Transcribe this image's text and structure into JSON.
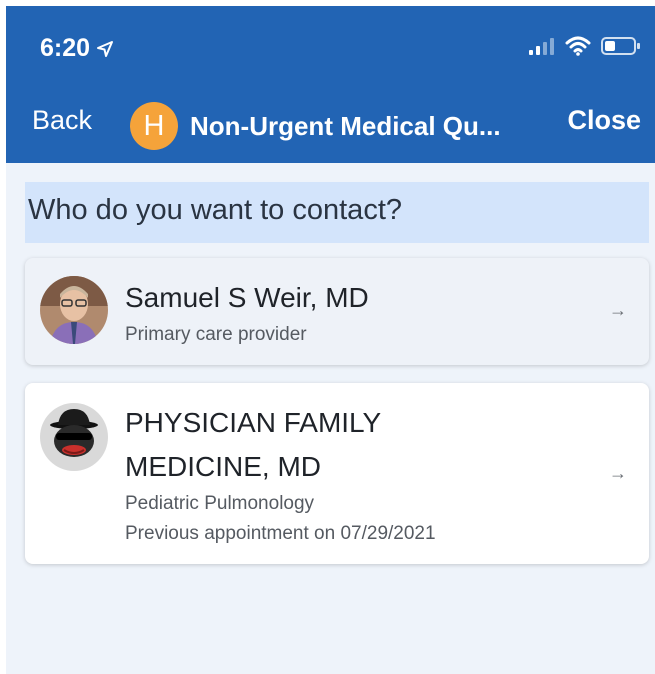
{
  "status_bar": {
    "time": "6:20"
  },
  "nav": {
    "back_label": "Back",
    "org_initial": "H",
    "title": "Non-Urgent Medical Qu...",
    "close_label": "Close"
  },
  "prompt": "Who do you want to contact?",
  "providers": [
    {
      "name": "Samuel S Weir, MD",
      "details": [
        "Primary care provider"
      ]
    },
    {
      "name_line1": "PHYSICIAN FAMILY",
      "name_line2": "MEDICINE, MD",
      "details": [
        "Pediatric Pulmonology",
        "Previous appointment on 07/29/2021"
      ]
    }
  ],
  "icons": {
    "location": "location-arrow-icon",
    "signal": "cellular-signal-icon",
    "wifi": "wifi-icon",
    "battery": "battery-icon",
    "chevron": "right-arrow-icon"
  },
  "colors": {
    "header": "#2264b4",
    "badge": "#f5a33a",
    "prompt_bg": "#d3e4fb",
    "page_bg": "#eef3fa"
  }
}
